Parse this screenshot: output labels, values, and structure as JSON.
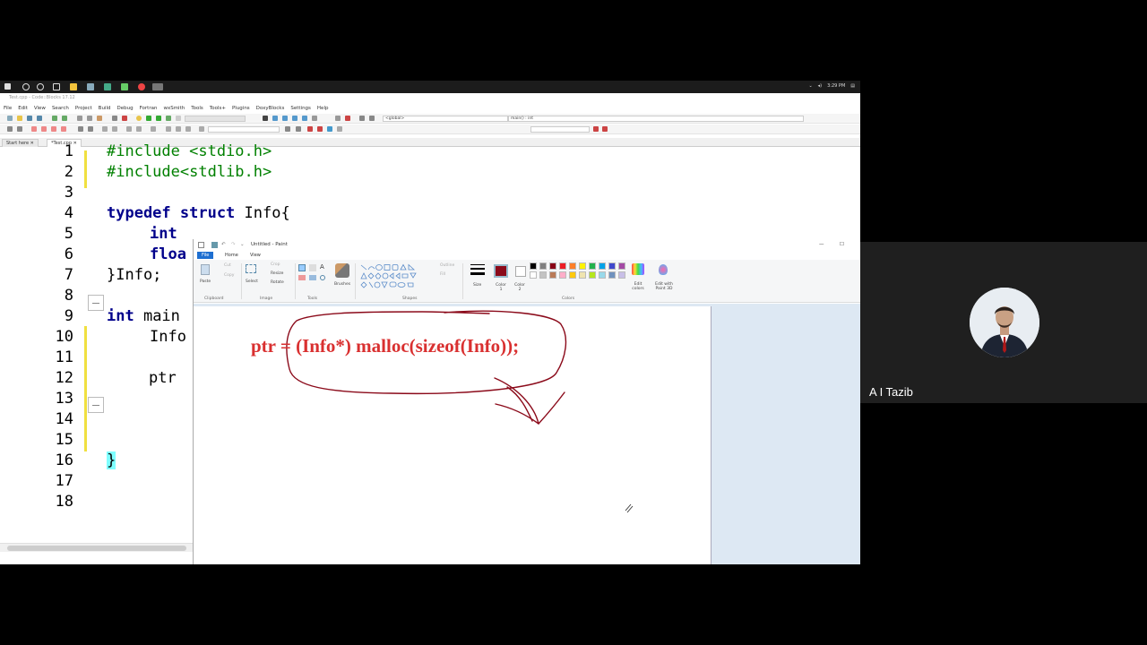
{
  "taskbar": {
    "clock": "3:29 PM"
  },
  "codeblocks": {
    "title": "Test.cpp - Code::Blocks 17.12",
    "menu": [
      "File",
      "Edit",
      "View",
      "Search",
      "Project",
      "Build",
      "Debug",
      "Fortran",
      "wxSmith",
      "Tools",
      "Tools+",
      "Plugins",
      "DoxyBlocks",
      "Settings",
      "Help"
    ],
    "scope_select": "<global>",
    "symbol_select": "main() : int",
    "tabs": [
      "Start here",
      "*Test.cpp"
    ],
    "line_numbers": [
      "1",
      "2",
      "3",
      "4",
      "5",
      "6",
      "7",
      "8",
      "9",
      "10",
      "11",
      "12",
      "13",
      "14",
      "15",
      "16",
      "17",
      "18"
    ],
    "code": {
      "l1": "#include <stdio.h>",
      "l2": "#include<stdlib.h>",
      "l4_kw": "typedef struct",
      "l4_rest": " Info{",
      "l5_kw": "int",
      "l6_kw": "floa",
      "l7": "}Info;",
      "l9_kw": "int",
      "l9_rest": " main",
      "l10": "Info",
      "l12": "ptr",
      "l16": "}"
    }
  },
  "paint": {
    "title": "Untitled - Paint",
    "tabs": {
      "file": "File",
      "home": "Home",
      "view": "View"
    },
    "ribbon": {
      "paste": "Paste",
      "cut": "Cut",
      "copy": "Copy",
      "select": "Select",
      "crop": "Crop",
      "resize": "Resize",
      "rotate": "Rotate",
      "brushes": "Brushes",
      "outline": "Outline",
      "fill": "Fill",
      "size": "Size",
      "color1": "Color 1",
      "color2": "Color 2",
      "edit_colors": "Edit colors",
      "paint3d": "Edit with Paint 3D",
      "groups": {
        "clipboard": "Clipboard",
        "image": "Image",
        "tools": "Tools",
        "shapes": "Shapes",
        "colors": "Colors"
      }
    },
    "active_color": "#8b0a1a",
    "palette": [
      "#000000",
      "#7f7f7f",
      "#880015",
      "#ed1c24",
      "#ff7f27",
      "#fff200",
      "#22b14c",
      "#00a2e8",
      "#3f48cc",
      "#a349a4",
      "#ffffff",
      "#c3c3c3",
      "#b97a57",
      "#ffaec9",
      "#ffc90e",
      "#efe4b0",
      "#b5e61d",
      "#99d9ea",
      "#7092be",
      "#c8bfe7"
    ],
    "canvas_text": "ptr = (Info*) malloc(sizeof(Info));"
  },
  "participant": {
    "name": "A I Tazib"
  }
}
